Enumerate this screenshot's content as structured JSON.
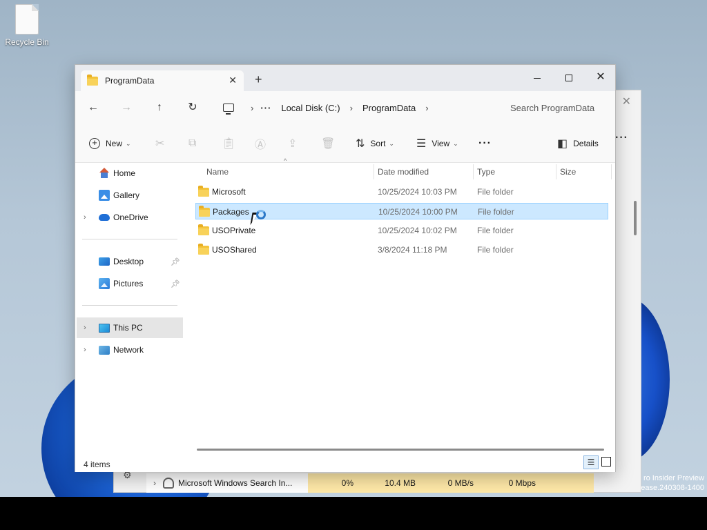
{
  "desktop": {
    "recycle_bin_label": "Recycle Bin",
    "watermark_line1": "ro Insider Preview",
    "watermark_line2": "ease.240308-1400"
  },
  "background_window": {
    "process_name": "Microsoft Windows Search In...",
    "cpu": "0%",
    "memory": "10.4 MB",
    "disk": "0 MB/s",
    "network": "0 Mbps"
  },
  "explorer": {
    "tab_title": "ProgramData",
    "tab_close": "✕",
    "new_tab": "+",
    "window_controls": {
      "close": "✕"
    },
    "nav": {
      "back": "←",
      "forward": "→",
      "up": "↑",
      "refresh": "↻"
    },
    "address": {
      "crumbs": [
        "Local Disk (C:)",
        "ProgramData"
      ],
      "more": "···",
      "separator": "›"
    },
    "search_placeholder": "Search ProgramData",
    "toolbar": {
      "new_label": "New",
      "sort_label": "Sort",
      "view_label": "View",
      "more": "···",
      "details_label": "Details"
    },
    "sidebar": {
      "items": [
        {
          "label": "Home",
          "icon": "home-icon"
        },
        {
          "label": "Gallery",
          "icon": "gallery-icon"
        },
        {
          "label": "OneDrive",
          "icon": "onedrive-icon"
        },
        {
          "label": "Desktop",
          "icon": "desktop-folder-icon"
        },
        {
          "label": "Pictures",
          "icon": "pictures-folder-icon"
        },
        {
          "label": "This PC",
          "icon": "this-pc-icon"
        },
        {
          "label": "Network",
          "icon": "network-icon"
        }
      ]
    },
    "columns": {
      "name": "Name",
      "date": "Date modified",
      "type": "Type",
      "size": "Size"
    },
    "rows": [
      {
        "name": "Microsoft",
        "date": "10/25/2024 10:03 PM",
        "type": "File folder",
        "size": ""
      },
      {
        "name": "Packages",
        "date": "10/25/2024 10:00 PM",
        "type": "File folder",
        "size": ""
      },
      {
        "name": "USOPrivate",
        "date": "10/25/2024 10:02 PM",
        "type": "File folder",
        "size": ""
      },
      {
        "name": "USOShared",
        "date": "3/8/2024 11:18 PM",
        "type": "File folder",
        "size": ""
      }
    ],
    "selected_row": "Packages",
    "status": {
      "item_count": "4 items"
    }
  },
  "colors": {
    "selection_bg": "#cce8ff",
    "selection_border": "#99d1ff",
    "folder": "#f3c33a",
    "accent": "#2b78c8"
  }
}
